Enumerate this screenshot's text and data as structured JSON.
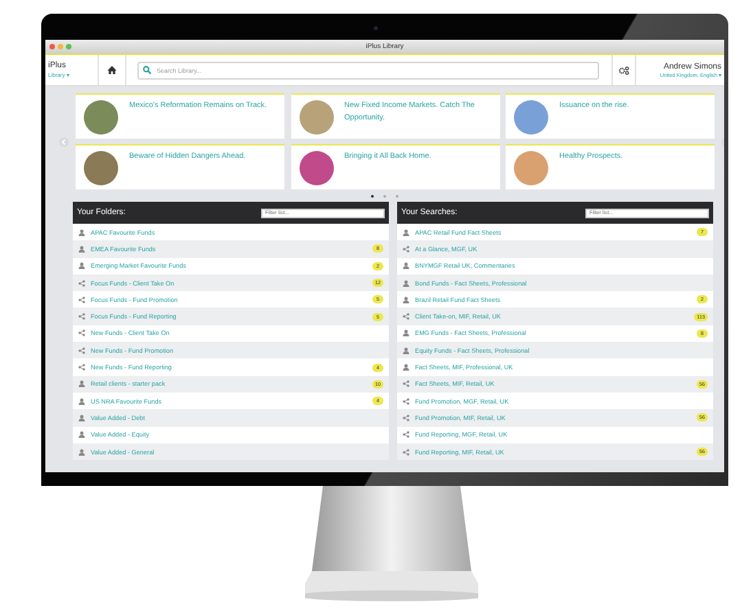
{
  "window": {
    "title": "iPlus Library"
  },
  "header": {
    "logo": "iPlus",
    "logo_menu": "Library ▾",
    "search": {
      "placeholder": "Search Library..."
    },
    "user": {
      "name": "Andrew Simons",
      "locale": "United Kingdom, English ▾"
    }
  },
  "carousel": {
    "articles": [
      {
        "title": "Mexico's Reformation Remains on Track."
      },
      {
        "title": "New Fixed Income Markets. Catch The Opportunity."
      },
      {
        "title": "Issuance on the rise."
      },
      {
        "title": "Beware of Hidden Dangers Ahead."
      },
      {
        "title": "Bringing it All Back Home."
      },
      {
        "title": "Healthy Prospects."
      }
    ],
    "dots": [
      {
        "selected": true
      },
      {
        "selected": false
      },
      {
        "selected": false
      }
    ]
  },
  "panels": [
    {
      "title": "Your Folders:",
      "filter": {
        "placeholder": "Filter list..."
      },
      "items": [
        {
          "kind": "person",
          "label": "APAC Favourite Funds"
        },
        {
          "kind": "person",
          "label": "EMEA Favourite Funds",
          "count": "8"
        },
        {
          "kind": "person",
          "label": "Emerging Market Favourite Funds",
          "count": "2"
        },
        {
          "kind": "shared",
          "label": "Focus Funds - Client Take On",
          "count": "12"
        },
        {
          "kind": "shared",
          "label": "Focus Funds - Fund Promotion",
          "count": "5"
        },
        {
          "kind": "shared",
          "label": "Focus Funds - Fund Reporting",
          "count": "5"
        },
        {
          "kind": "shared",
          "label": "New Funds - Client Take On"
        },
        {
          "kind": "shared",
          "label": "New Funds - Fund Promotion"
        },
        {
          "kind": "shared",
          "label": "New Funds - Fund Reporting",
          "count": "4"
        },
        {
          "kind": "person",
          "label": "Retail clients - starter pack",
          "count": "10"
        },
        {
          "kind": "person",
          "label": "US NRA Favourite Funds",
          "count": "4"
        },
        {
          "kind": "person",
          "label": "Value Added - Debt"
        },
        {
          "kind": "person",
          "label": "Value Added - Equity"
        },
        {
          "kind": "person",
          "label": "Value Added - General"
        }
      ]
    },
    {
      "title": "Your Searches:",
      "filter": {
        "placeholder": "Filter list..."
      },
      "items": [
        {
          "kind": "person",
          "label": "APAC Retail Fund Fact Sheets",
          "count": "7"
        },
        {
          "kind": "shared",
          "label": "At a Glance, MGF, UK"
        },
        {
          "kind": "person",
          "label": "BNYMGF Retail UK, Commentaries"
        },
        {
          "kind": "person",
          "label": "Bond Funds - Fact Sheets, Professional"
        },
        {
          "kind": "person",
          "label": "Brazil Retail Fund Fact Sheets",
          "count": "2"
        },
        {
          "kind": "shared",
          "label": "Client Take-on, MIF, Retail, UK",
          "count": "113"
        },
        {
          "kind": "person",
          "label": "EMG Funds - Fact Sheets, Professional",
          "count": "8"
        },
        {
          "kind": "person",
          "label": "Equity Funds - Fact Sheets, Professional"
        },
        {
          "kind": "person",
          "label": "Fact Sheets, MIF, Professional, UK"
        },
        {
          "kind": "shared",
          "label": "Fact Sheets, MIF, Retail, UK",
          "count": "56"
        },
        {
          "kind": "shared",
          "label": "Fund Promotion, MGF, Retail, UK"
        },
        {
          "kind": "shared",
          "label": "Fund Promotion, MIF, Retail, UK",
          "count": "56"
        },
        {
          "kind": "shared",
          "label": "Fund Reporting, MGF, Retail, UK"
        },
        {
          "kind": "shared",
          "label": "Fund Reporting, MIF, Retail, UK",
          "count": "56"
        }
      ]
    }
  ]
}
